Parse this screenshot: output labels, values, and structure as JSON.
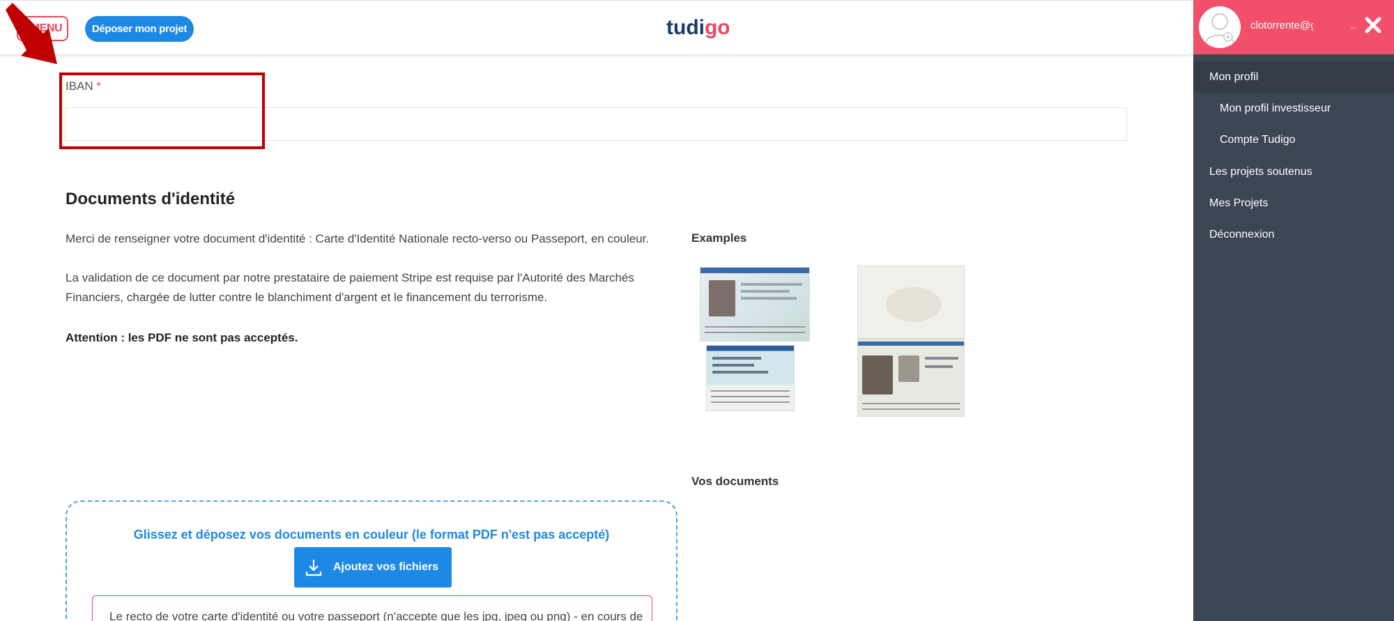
{
  "header": {
    "menu_label": "MENU",
    "deposer_label": "Déposer mon projet",
    "logo_text": "tudigo",
    "logo_colors": {
      "tud": "#1b3a6b",
      "i": "#1b3a6b",
      "go": "#e8475f"
    }
  },
  "form": {
    "iban_label": "IBAN",
    "iban_required_mark": "*",
    "iban_value": ""
  },
  "documents": {
    "title": "Documents d'identité",
    "para1": "Merci de renseigner votre document d'identité : Carte d'Identité Nationale recto-verso ou Passeport, en couleur.",
    "para2": "La validation de ce document par notre prestataire de paiement Stripe est requise par l'Autorité des Marchés Financiers, chargée de lutter contre le blanchiment d'argent et le financement du terrorisme.",
    "para3": "Attention : les PDF ne sont pas acceptés.",
    "examples_title": "Examples",
    "vos_documents_title": "Vos documents"
  },
  "dropzone": {
    "instruction": "Glissez et déposez vos documents en couleur (le format PDF n'est pas accepté)",
    "add_button_label": "Ajoutez vos fichiers",
    "notice": "Le recto de votre carte d'identité ou votre passeport (n'accepte que les jpg, jpeg ou png) - en cours de"
  },
  "side_panel": {
    "email": "clotorrente@g",
    "ellipsis": "..",
    "items": [
      {
        "label": "Mon profil",
        "active": true
      },
      {
        "label": "Mon profil investisseur"
      },
      {
        "label": "Compte Tudigo"
      },
      {
        "label": "Les projets soutenus"
      },
      {
        "label": "Mes Projets"
      },
      {
        "label": "Déconnexion"
      }
    ]
  },
  "colors": {
    "accent_blue": "#1e88e5",
    "accent_pink": "#f2506a",
    "panel_dark": "#3b4653",
    "annotation_red": "#c00000"
  },
  "icons": [
    "close-icon",
    "download-icon",
    "avatar-icon",
    "annotation-arrow"
  ]
}
